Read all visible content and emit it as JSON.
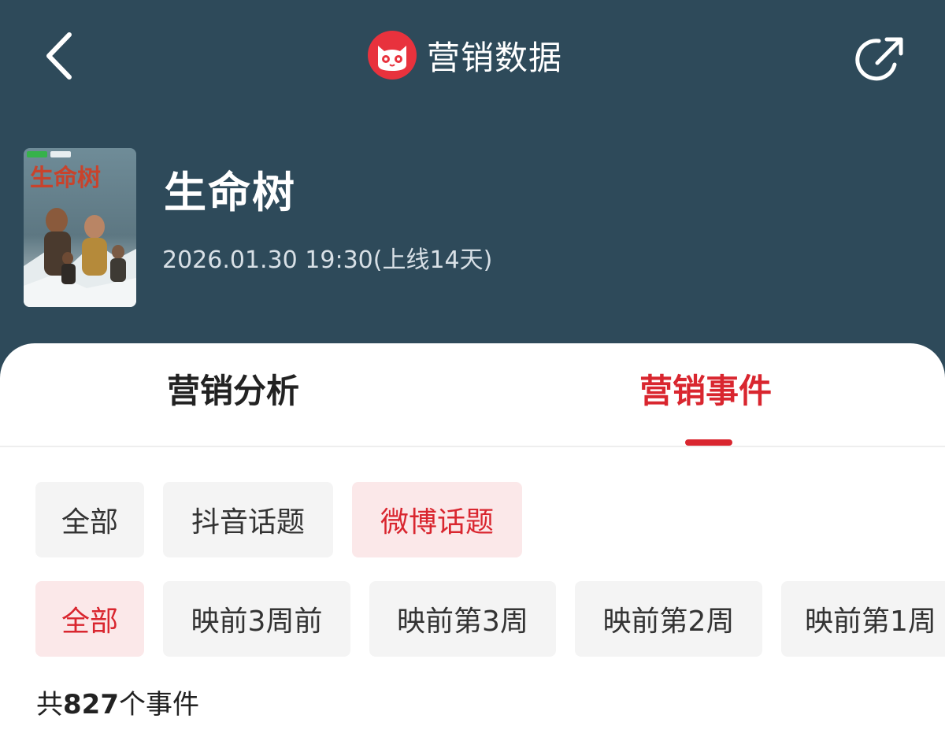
{
  "header": {
    "app_title": "营销数据",
    "back_icon": "chevron-left-icon",
    "share_icon": "share-icon",
    "logo_icon": "maoyan-cat-logo",
    "brand_color": "#e8323d",
    "header_bg": "#2e4a5a"
  },
  "movie": {
    "title": "生命树",
    "release": "2026.01.30 19:30(上线14天)",
    "poster_title": "生命树"
  },
  "tabs": [
    {
      "label": "营销分析",
      "active": false
    },
    {
      "label": "营销事件",
      "active": true
    }
  ],
  "accent_color": "#d9262f",
  "platform_filters": [
    {
      "label": "全部",
      "active": false
    },
    {
      "label": "抖音话题",
      "active": false
    },
    {
      "label": "微博话题",
      "active": true
    }
  ],
  "period_filters": [
    {
      "label": "全部",
      "active": true
    },
    {
      "label": "映前3周前",
      "active": false
    },
    {
      "label": "映前第3周",
      "active": false
    },
    {
      "label": "映前第2周",
      "active": false
    },
    {
      "label": "映前第1周",
      "active": false
    }
  ],
  "summary": {
    "prefix": "共",
    "count": "827",
    "suffix": "个事件"
  }
}
